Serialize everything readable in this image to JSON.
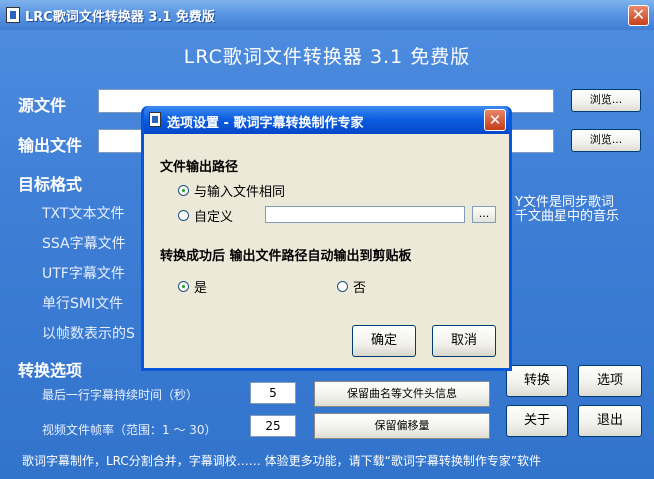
{
  "window": {
    "title": "LRC歌词文件转换器 3.1 免费版",
    "banner": "LRC歌词文件转换器 3.1 免费版",
    "close": "✕"
  },
  "source": {
    "label": "源文件",
    "value": "",
    "browse": "浏览..."
  },
  "output": {
    "label": "输出文件",
    "value": "",
    "browse": "浏览..."
  },
  "target": {
    "label": "目标格式",
    "formats": [
      "TXT文本文件",
      "SSA字幕文件",
      "UTF字幕文件",
      "单行SMI文件",
      "以帧数表示的S"
    ],
    "side_note": [
      "Y文件是同步歌词",
      "千文曲星中的音乐"
    ]
  },
  "options": {
    "label": "转换选项",
    "last_line_label": "最后一行字幕持续时间（秒）",
    "last_line_value": "5",
    "keep_header": "保留曲名等文件头信息",
    "fps_label": "视频文件帧率（范围：1 ～ 30）",
    "fps_value": "25",
    "keep_offset": "保留偏移量"
  },
  "actions": {
    "convert": "转换",
    "options": "选项",
    "about": "关于",
    "exit": "退出"
  },
  "footer": "歌词字幕制作，LRC分割合并，字幕调校…… 体验更多功能，请下载“歌词字幕转换制作专家”软件",
  "dialog": {
    "title": "选项设置 - 歌词字幕转换制作专家",
    "close": "✕",
    "path_heading": "文件输出路径",
    "same_as_input": "与输入文件相同",
    "custom": "自定义",
    "custom_value": "",
    "dots": "...",
    "clipboard_heading": "转换成功后 输出文件路径自动输出到剪贴板",
    "yes": "是",
    "no": "否",
    "ok": "确定",
    "cancel": "取消"
  },
  "colors": {
    "window_bg": "#3f7fd6",
    "dialog_border": "#0a56d8",
    "dialog_face": "#ece9d8"
  }
}
